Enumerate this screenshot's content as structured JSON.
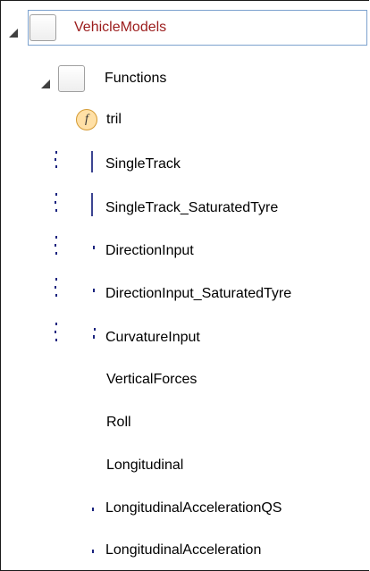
{
  "tree": {
    "root": {
      "label": "VehicleModels"
    },
    "functions": {
      "label": "Functions"
    },
    "items": [
      {
        "label": "tril",
        "icon": "function-icon",
        "icon_text": "f"
      },
      {
        "label": "SingleTrack"
      },
      {
        "label": "SingleTrack_SaturatedTyre"
      },
      {
        "label": "DirectionInput"
      },
      {
        "label": "DirectionInput_SaturatedTyre"
      },
      {
        "label": "CurvatureInput"
      },
      {
        "label": "VerticalForces"
      },
      {
        "label": "Roll"
      },
      {
        "label": "Longitudinal"
      },
      {
        "label": "LongitudinalAccelerationQS"
      },
      {
        "label": "LongitudinalAcceleration"
      }
    ]
  },
  "colors": {
    "root_label": "#9b1c1c",
    "selection_border": "#7da2ce",
    "function_icon_fill": "#ffe0a6",
    "function_icon_border": "#d49a32",
    "glyph_blue": "#1a237e"
  }
}
